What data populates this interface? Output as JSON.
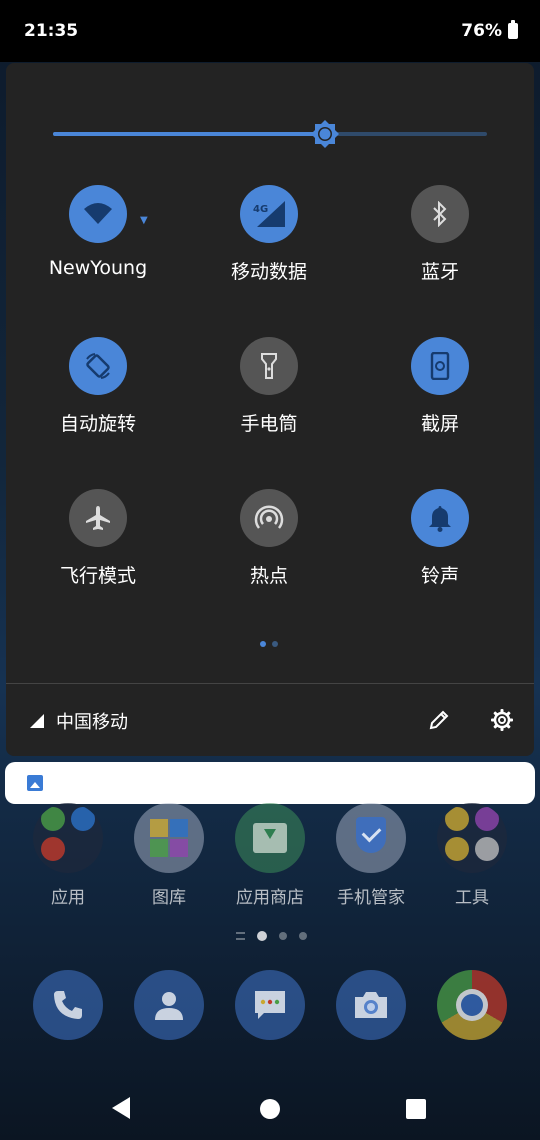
{
  "status_bar": {
    "time": "21:35",
    "battery": "76%"
  },
  "quick_settings": {
    "brightness_level": 0.627,
    "tiles": [
      {
        "label": "NewYoung",
        "icon": "wifi-icon",
        "on": true
      },
      {
        "label": "移动数据",
        "icon": "mobile-data-icon",
        "badge": "4G",
        "on": true
      },
      {
        "label": "蓝牙",
        "icon": "bluetooth-icon",
        "on": false
      },
      {
        "label": "自动旋转",
        "icon": "auto-rotate-icon",
        "on": true
      },
      {
        "label": "手电筒",
        "icon": "flashlight-icon",
        "on": false
      },
      {
        "label": "截屏",
        "icon": "screenshot-icon",
        "on": true
      },
      {
        "label": "飞行模式",
        "icon": "airplane-icon",
        "on": false
      },
      {
        "label": "热点",
        "icon": "hotspot-icon",
        "on": false
      },
      {
        "label": "铃声",
        "icon": "bell-icon",
        "on": true
      }
    ],
    "page_indicator": {
      "current": 1,
      "total": 2
    },
    "carrier": "中国移动"
  },
  "home": {
    "apps": [
      {
        "label": "应用"
      },
      {
        "label": "图库"
      },
      {
        "label": "应用商店"
      },
      {
        "label": "手机管家"
      },
      {
        "label": "工具"
      }
    ],
    "dock": [
      "phone-icon",
      "contacts-icon",
      "messages-icon",
      "camera-icon",
      "chrome-icon"
    ]
  },
  "colors": {
    "accent": "#4a86d8",
    "tile_off": "#555555",
    "panel": "#232323"
  }
}
